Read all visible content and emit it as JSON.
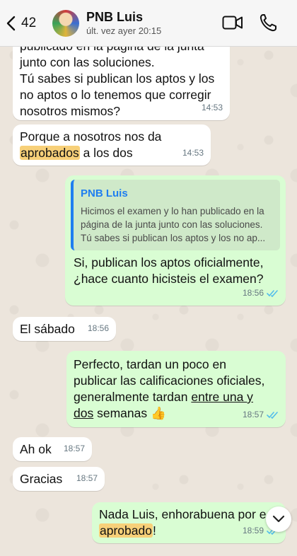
{
  "header": {
    "back_count": "42",
    "contact_name": "PNB Luis",
    "status": "últ. vez ayer 20:15"
  },
  "messages": [
    {
      "direction": "in",
      "lines": [
        "publicado en la página de la junta",
        "junto con las soluciones.",
        "Tú sabes si publican los aptos y los",
        "no aptos o lo tenemos que corregir",
        "nosotros mismos?"
      ],
      "time": "14:53"
    },
    {
      "direction": "in",
      "line1": "Porque a nosotros nos da",
      "highlight": "aprobados",
      "line2_rest": " a los dos",
      "time": "14:53"
    },
    {
      "direction": "out",
      "quote_name": "PNB Luis",
      "quote_lines": [
        "Hicimos el examen y lo han publicado en la",
        "página de la junta junto con las soluciones.",
        "Tú sabes si publican los aptos y los no ap..."
      ],
      "lines": [
        "Si, publican los aptos oficialmente,",
        "¿hace cuanto hicisteis el examen?"
      ],
      "time": "18:56",
      "status": "read"
    },
    {
      "direction": "in",
      "text": "El sábado",
      "time": "18:56"
    },
    {
      "direction": "out",
      "line1": "Perfecto, tardan un poco en",
      "line2": "publicar las calificaciones oficiales,",
      "line3_pre": "generalmente tardan ",
      "line3_link": "entre una y",
      "line4_link": "dos",
      "line4_rest": " semanas ",
      "emoji": "👍",
      "time": "18:57",
      "status": "read"
    },
    {
      "direction": "in",
      "text": "Ah ok",
      "time": "18:57"
    },
    {
      "direction": "in",
      "text": "Gracias",
      "time": "18:57"
    },
    {
      "direction": "out",
      "line1": "Nada Luis, enhorabuena por e",
      "highlight": "aprobado",
      "line2_rest": "!",
      "time": "18:59",
      "status": "read"
    }
  ],
  "colors": {
    "incoming": "#ffffff",
    "outgoing": "#d9fdd3",
    "highlight": "#f7d079",
    "read_ticks": "#53bdeb",
    "quote_accent": "#1f7ef0"
  }
}
